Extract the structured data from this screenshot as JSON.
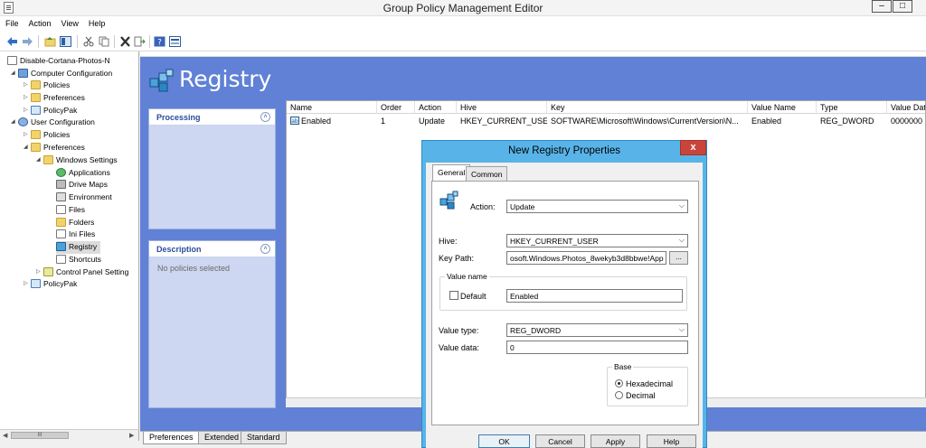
{
  "window": {
    "title": "Group Policy Management Editor",
    "minimize": "–",
    "maximize": "□"
  },
  "menu": [
    "File",
    "Action",
    "View",
    "Help"
  ],
  "tree": {
    "root": "Disable-Cortana-Photos-N",
    "computer_config": "Computer Configuration",
    "cc_policies": "Policies",
    "cc_preferences": "Preferences",
    "cc_policypak": "PolicyPak",
    "user_config": "User Configuration",
    "uc_policies": "Policies",
    "uc_preferences": "Preferences",
    "windows_settings": "Windows Settings",
    "applications": "Applications",
    "drive_maps": "Drive Maps",
    "environment": "Environment",
    "files": "Files",
    "folders": "Folders",
    "ini_files": "Ini Files",
    "registry": "Registry",
    "shortcuts": "Shortcuts",
    "control_panel": "Control Panel Setting",
    "uc_policypak": "PolicyPak"
  },
  "tree_scroll_thumb": "III",
  "header": {
    "title": "Registry"
  },
  "panels": {
    "processing": "Processing",
    "description": "Description",
    "description_text": "No policies selected",
    "collapse_glyph": "˄"
  },
  "list": {
    "columns": [
      "Name",
      "Order",
      "Action",
      "Hive",
      "Key",
      "Value Name",
      "Type",
      "Value Data"
    ],
    "row": {
      "name": "Enabled",
      "order": "1",
      "action": "Update",
      "hive": "HKEY_CURRENT_USER",
      "key": "SOFTWARE\\Microsoft\\Windows\\CurrentVersion\\N...",
      "value_name": "Enabled",
      "type": "REG_DWORD",
      "value_data": "0000000"
    }
  },
  "bottom_tabs": [
    "Preferences",
    "Extended",
    "Standard"
  ],
  "dialog": {
    "title": "New Registry Properties",
    "close": "x",
    "tabs": [
      "General",
      "Common"
    ],
    "action_label": "Action:",
    "action_value": "Update",
    "hive_label": "Hive:",
    "hive_value": "HKEY_CURRENT_USER",
    "key_path_label": "Key Path:",
    "key_path_value": "osoft.Windows.Photos_8wekyb3d8bbwe!App",
    "browse": "...",
    "value_name_group": "Value name",
    "default_label": "Default",
    "value_name_value": "Enabled",
    "value_type_label": "Value type:",
    "value_type_value": "REG_DWORD",
    "value_data_label": "Value data:",
    "value_data_value": "0",
    "base_group": "Base",
    "hexadecimal": "Hexadecimal",
    "decimal": "Decimal",
    "buttons": [
      "OK",
      "Cancel",
      "Apply",
      "Help"
    ]
  },
  "colors": {
    "accent_blue": "#6081d6",
    "dialog_frame": "#58b4e8",
    "close_red": "#c9453b"
  }
}
